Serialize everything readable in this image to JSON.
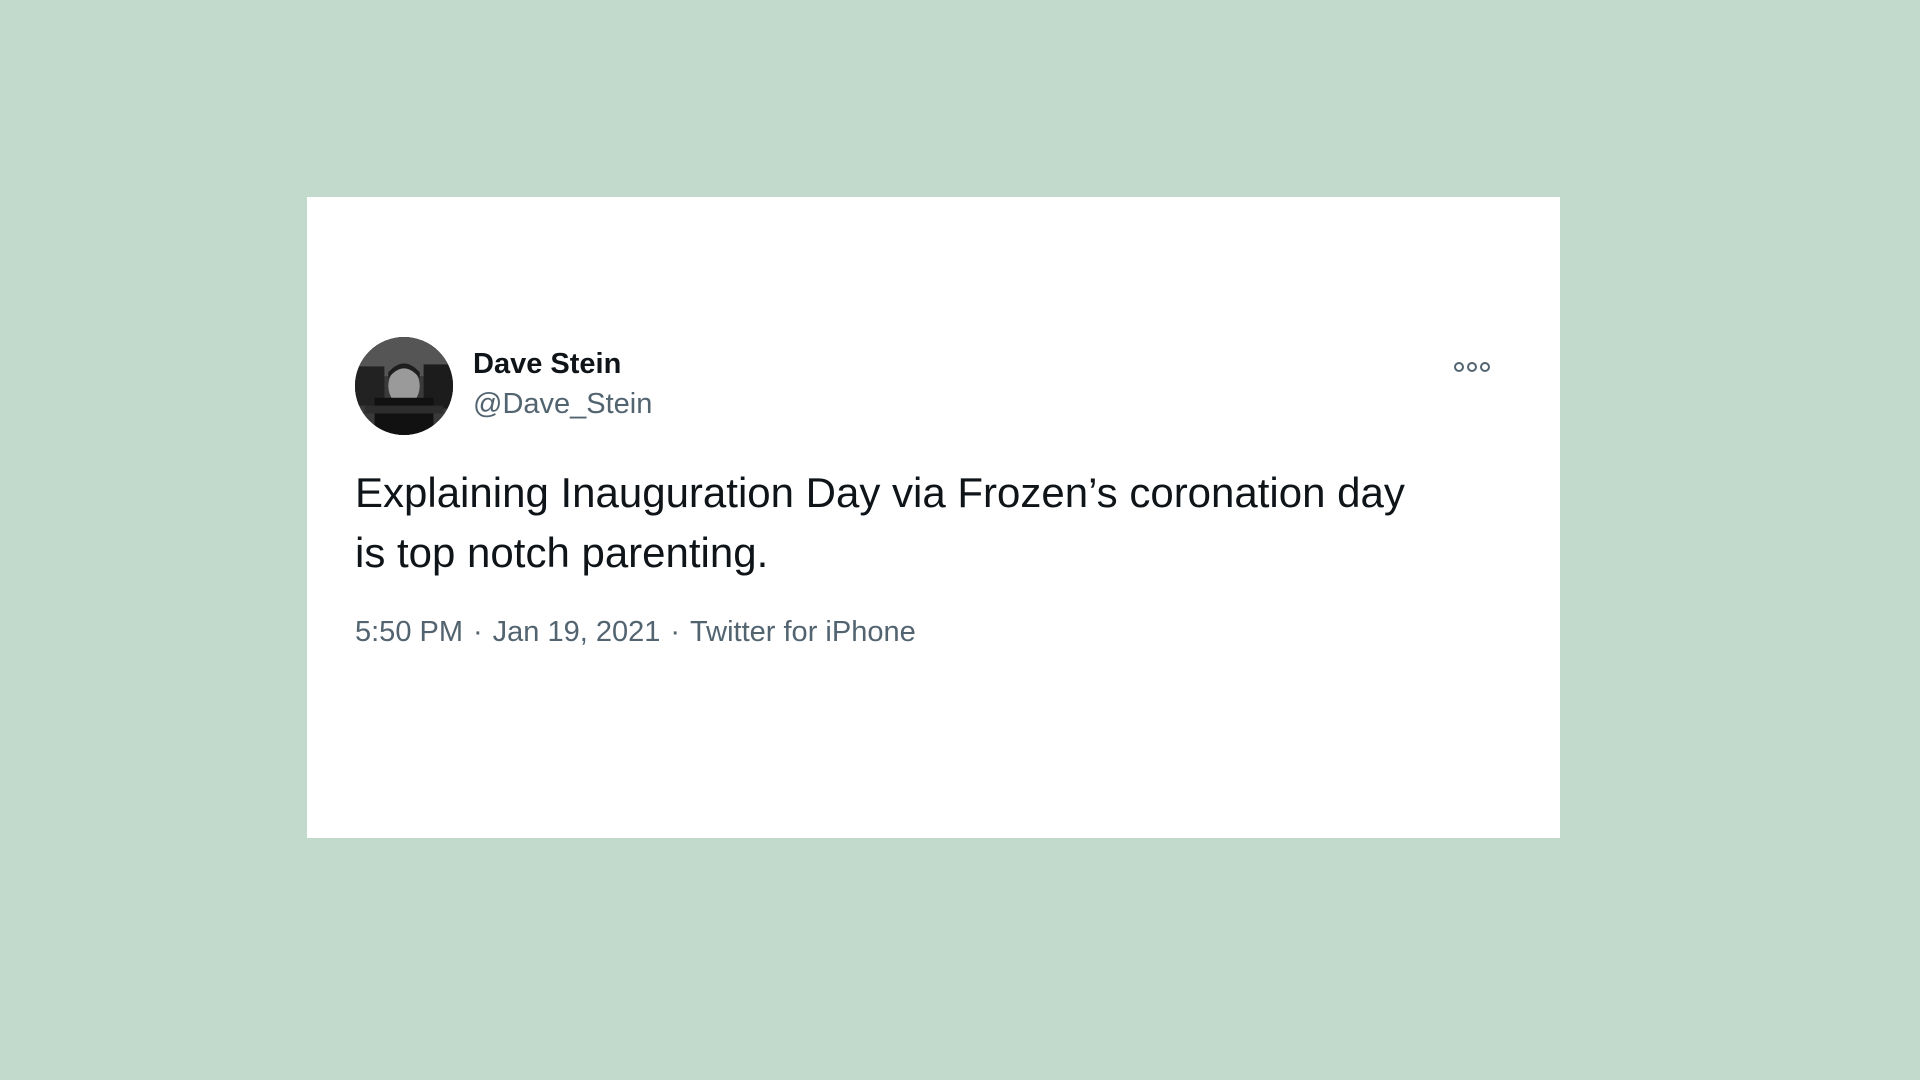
{
  "tweet": {
    "display_name": "Dave Stein",
    "handle": "@Dave_Stein",
    "text_line1": "Explaining Inauguration Day via Frozen’s coronation day",
    "text_line2": "is top notch parenting.",
    "time": "5:50 PM",
    "separator": "·",
    "date": "Jan 19, 2021",
    "source": "Twitter for iPhone",
    "avatar_icon": "profile-photo",
    "more_icon": "more-options-icon"
  },
  "colors": {
    "background": "#c2dacc",
    "card": "#ffffff",
    "primary_text": "#0f1419",
    "secondary_text": "#536471"
  }
}
